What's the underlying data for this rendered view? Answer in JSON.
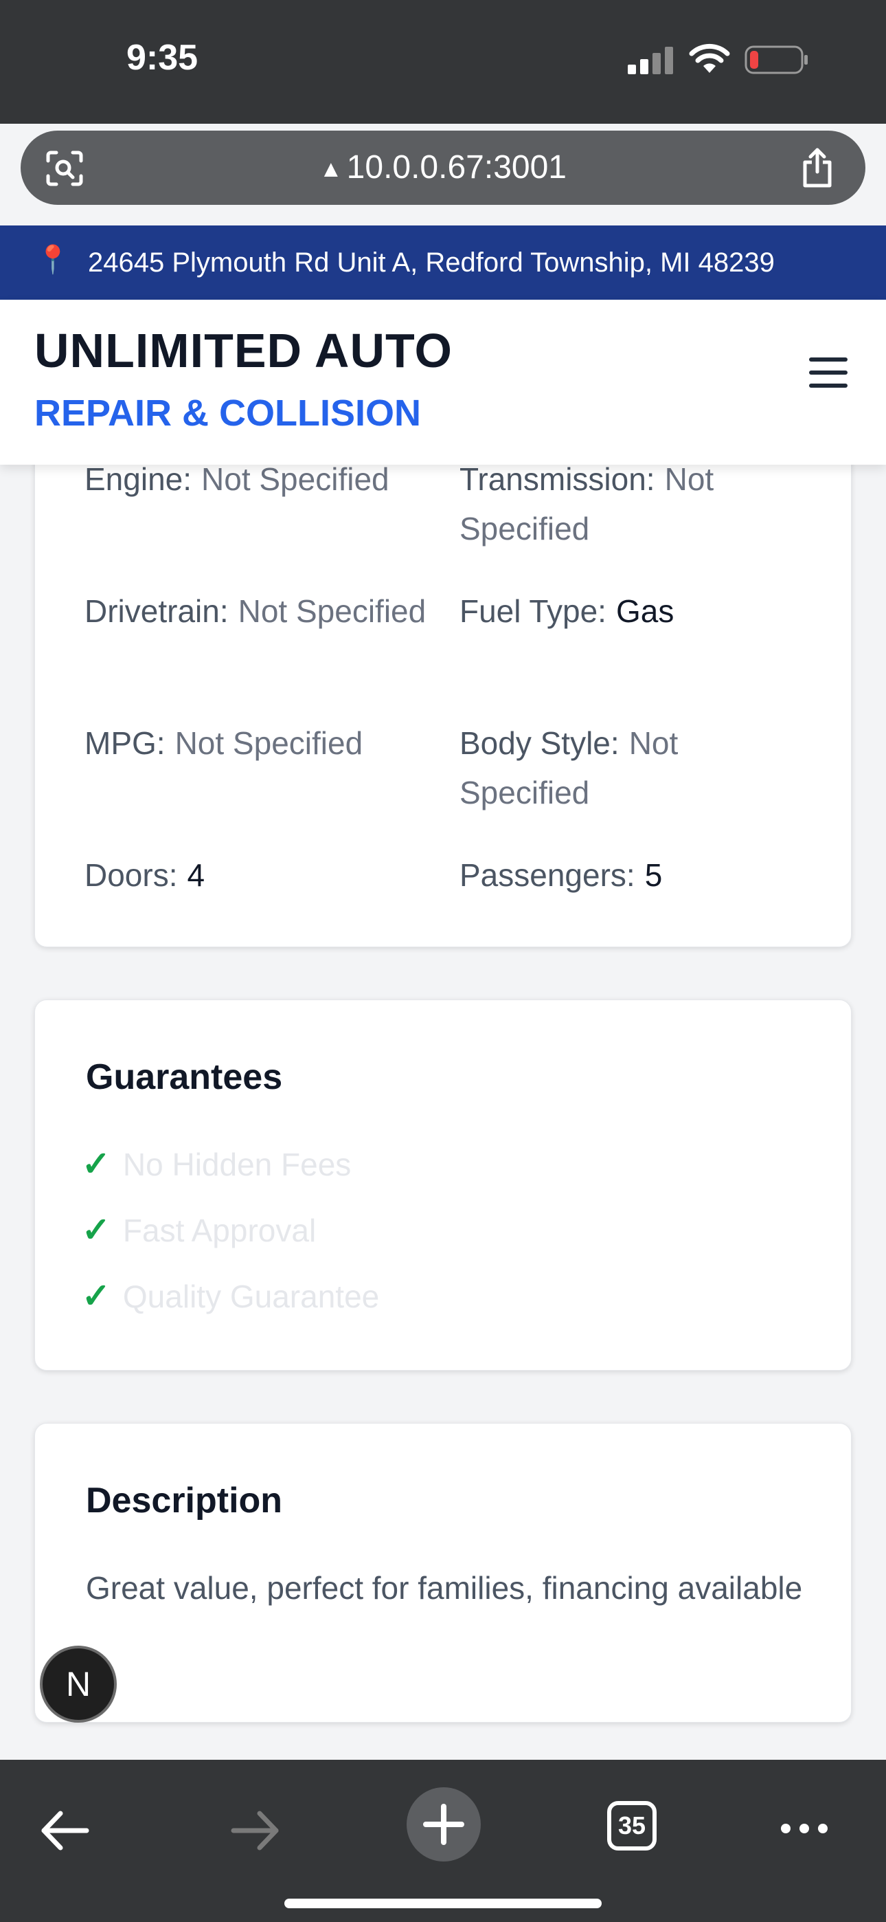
{
  "status_bar": {
    "time": "9:35"
  },
  "browser": {
    "url": "10.0.0.67:3001",
    "tab_count": "35"
  },
  "location_banner": {
    "address": "24645 Plymouth Rd Unit A, Redford Township, MI 48239"
  },
  "header": {
    "brand_main": "UNLIMITED AUTO",
    "brand_sub": "REPAIR & COLLISION"
  },
  "specs": {
    "engine": {
      "label": "Engine:",
      "value": "Not Specified"
    },
    "transmission": {
      "label": "Transmission:",
      "value": "Not Specified"
    },
    "drivetrain": {
      "label": "Drivetrain:",
      "value": "Not Specified"
    },
    "fuel_type": {
      "label": "Fuel Type:",
      "value": "Gas"
    },
    "mpg": {
      "label": "MPG:",
      "value": "Not Specified"
    },
    "body_style": {
      "label": "Body Style:",
      "value": "Not Specified"
    },
    "doors": {
      "label": "Doors:",
      "value": "4"
    },
    "passengers": {
      "label": "Passengers:",
      "value": "5"
    }
  },
  "guarantees": {
    "title": "Guarantees",
    "check": "✓",
    "items": [
      "No Hidden Fees",
      "Fast Approval",
      "Quality Guarantee"
    ]
  },
  "description": {
    "title": "Description",
    "text": "Great value, perfect for families, financing available"
  },
  "badge": {
    "letter": "N"
  },
  "colors": {
    "brand_blue": "#2563eb",
    "banner": "#1e3a8a",
    "check": "#16a34a"
  }
}
